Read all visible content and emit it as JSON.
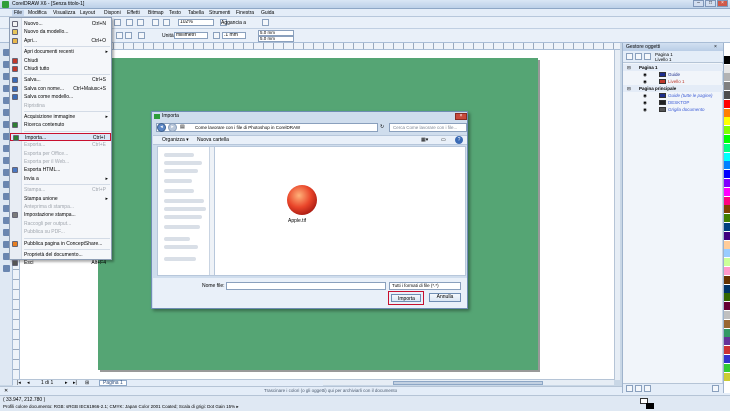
{
  "window": {
    "title": "CorelDRAW X6 - [Senza titolo-1]",
    "controls": [
      "–",
      "□",
      "×"
    ]
  },
  "menubar": [
    "File",
    "Modifica",
    "Visualizza",
    "Layout",
    "Disponi",
    "Effetti",
    "Bitmap",
    "Testo",
    "Tabella",
    "Strumenti",
    "Finestra",
    "Guida"
  ],
  "toolbar": {
    "zoom": "102%",
    "snap": "Aggancia a",
    "units_label": "Unità:",
    "units": "millimetri",
    "nudge": ".1 mm",
    "dup_x": "5.0 mm",
    "dup_y": "5.0 mm"
  },
  "file_menu": [
    {
      "label": "Nuovo...",
      "shortcut": "Ctrl+N",
      "icon": "new-doc-icon",
      "color": "#f2f2f2"
    },
    {
      "label": "Nuovo da modello...",
      "shortcut": "",
      "icon": "template-icon",
      "color": "#e6c65c"
    },
    {
      "label": "Apri...",
      "shortcut": "Ctrl+O",
      "icon": "open-folder-icon",
      "color": "#e8b84b"
    },
    {
      "label": "Apri documenti recenti",
      "shortcut": "",
      "submenu": true
    },
    {
      "label": "Chiudi",
      "shortcut": "",
      "icon": "close-doc-icon",
      "color": "#c0392b"
    },
    {
      "label": "Chiudi tutto",
      "shortcut": "",
      "icon": "close-all-icon",
      "color": "#c0392b"
    },
    {
      "label": "Salva...",
      "shortcut": "Ctrl+S",
      "icon": "save-icon",
      "color": "#3b6bb5"
    },
    {
      "label": "Salva con nome...",
      "shortcut": "Ctrl+Maiusc+S",
      "icon": "save-as-icon",
      "color": "#3b6bb5"
    },
    {
      "label": "Salva come modello...",
      "shortcut": "",
      "icon": "save-template-icon",
      "color": "#3b6bb5"
    },
    {
      "label": "Ripristina",
      "shortcut": "",
      "disabled": true
    },
    {
      "label": "Acquisizione immagine",
      "shortcut": "",
      "submenu": true
    },
    {
      "label": "Ricerca contenuto",
      "shortcut": "",
      "icon": "search-content-icon",
      "color": "#2e7d32"
    },
    {
      "label": "Importa...",
      "shortcut": "Ctrl+I",
      "icon": "import-icon",
      "color": "#2e7d32",
      "highlighted": true
    },
    {
      "label": "Esporta...",
      "shortcut": "Ctrl+E",
      "disabled": true
    },
    {
      "label": "Esporta per Office...",
      "shortcut": "",
      "disabled": true
    },
    {
      "label": "Esporta per il Web...",
      "shortcut": "",
      "disabled": true
    },
    {
      "label": "Esporta HTML...",
      "shortcut": "",
      "icon": "html-icon",
      "color": "#4a78c2"
    },
    {
      "label": "Invia a",
      "shortcut": "",
      "submenu": true
    },
    {
      "label": "Stampa...",
      "shortcut": "Ctrl+P",
      "disabled": true
    },
    {
      "label": "Stampa unione",
      "shortcut": "",
      "submenu": true
    },
    {
      "label": "Anteprima di stampa...",
      "shortcut": "",
      "disabled": true
    },
    {
      "label": "Impostazione stampa...",
      "shortcut": "",
      "icon": "print-setup-icon",
      "color": "#7a7a7a"
    },
    {
      "label": "Raccogli per output...",
      "shortcut": "",
      "disabled": true
    },
    {
      "label": "Pubblica su PDF...",
      "shortcut": "",
      "disabled": true
    },
    {
      "label": "Pubblica pagina in ConceptShare...",
      "shortcut": "",
      "icon": "conceptshare-icon",
      "color": "#e67e22"
    },
    {
      "label": "Proprietà del documento...",
      "shortcut": ""
    },
    {
      "label": "Esci",
      "shortcut": "Alt+F4",
      "icon": "exit-icon",
      "color": "#555555"
    }
  ],
  "dialog": {
    "title": "Importa",
    "path": "Come lavorare con i file di Photoshop in CorelDRAW",
    "search_placeholder": "Cerca Come lavorare con i file...",
    "organize": "Organizza ▾",
    "new_folder": "Nuova cartella",
    "file": {
      "name": "Apple.tif"
    },
    "filename_label": "Nome file:",
    "filetype": "Tutti i formati di file (*.*)",
    "import_btn": "Importa",
    "cancel_btn": "Annulla"
  },
  "docker": {
    "title": "Gestore oggetti",
    "page_header": [
      "Pagina 1",
      "Livello 1"
    ],
    "tree": [
      {
        "label": "Pagina 1",
        "bold": true,
        "indent": 1,
        "swatch": ""
      },
      {
        "label": "Guide",
        "indent": 2,
        "swatch": "#1c2c8c",
        "color": "#1c2c8c"
      },
      {
        "label": "Livello 1",
        "indent": 2,
        "swatch": "#c0392b",
        "color": "#c0392b"
      },
      {
        "label": "Pagina principale",
        "bold": true,
        "indent": 1,
        "swatch": ""
      },
      {
        "label": "Guide (tutte le pagine)",
        "indent": 2,
        "swatch": "#1c2c8c",
        "color": "#3b5bd6",
        "italic": true
      },
      {
        "label": "DESKTOP",
        "indent": 2,
        "swatch": "#222222",
        "color": "#3b5bd6"
      },
      {
        "label": "Griglia documento",
        "indent": 2,
        "swatch": "#555555",
        "color": "#3b5bd6",
        "italic": true
      }
    ]
  },
  "page_bar": {
    "counter": "1 di 1",
    "tab": "Pagina 1"
  },
  "status": {
    "coords": "( 33.947, 212.780 )",
    "hint": "Trascinare i colori (o gli oggetti) qui per archiviarli con il documento",
    "profile": "Profili colore documento: RGB: sRGB IEC61966-2.1; CMYK: Japan Color 2001 Coated; Scala di grigi: Dot Gain 15% ▸"
  },
  "colors": {
    "page": "#55a574",
    "accent_highlight": "#c8102e"
  }
}
